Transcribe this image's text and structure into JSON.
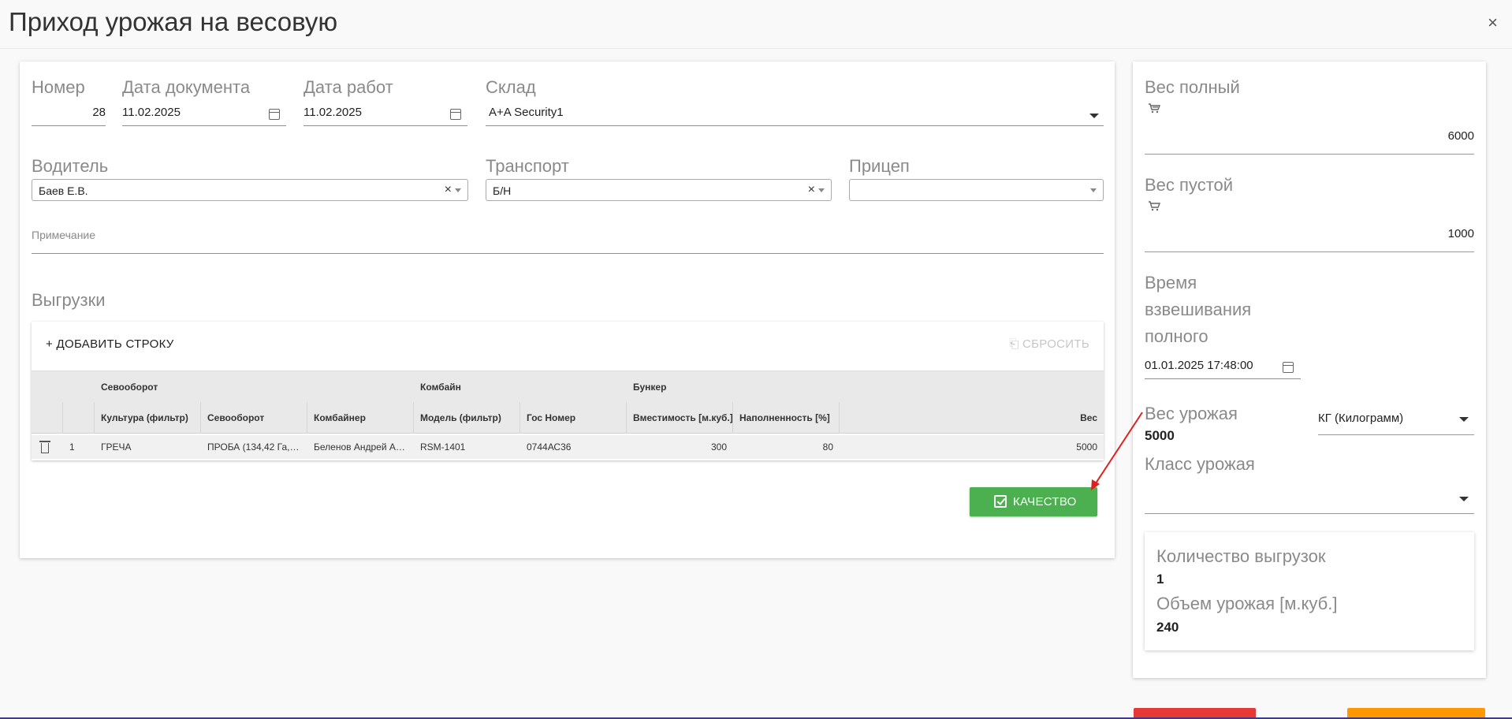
{
  "header": {
    "title": "Приход урожая на весовую",
    "close_glyph": "×"
  },
  "form": {
    "number": {
      "label": "Номер",
      "value": "28"
    },
    "doc_date": {
      "label": "Дата документа",
      "value": "11.02.2025"
    },
    "work_date": {
      "label": "Дата работ",
      "value": "11.02.2025"
    },
    "warehouse": {
      "label": "Склад",
      "value": "A+A Security1"
    },
    "driver": {
      "label": "Водитель",
      "value": "Баев Е.В."
    },
    "transport": {
      "label": "Транспорт",
      "value": "Б/Н"
    },
    "trailer": {
      "label": "Прицеп",
      "value": ""
    },
    "note": {
      "label": "Примечание",
      "value": ""
    }
  },
  "unloads": {
    "title": "Выгрузки",
    "add_label": "+ ДОБАВИТЬ СТРОКУ",
    "reset_label": "⎗ СБРОСИТЬ",
    "groups": [
      "Севооборот",
      "Комбайн",
      "Бункер"
    ],
    "columns": [
      "Культура (фильтр)",
      "Севооборот",
      "Комбайнер",
      "Модель (фильтр)",
      "Гос Номер",
      "Вместимость [м.куб.]",
      "Наполненность [%]",
      "Вес"
    ],
    "rows": [
      {
        "num": "1",
        "culture": "ГРЕЧА",
        "rotation": "ПРОБА (134,42 Га, \"...",
        "operator": "Беленов Андрей Ан...",
        "model": "RSM-1401",
        "plate": "0744АС36",
        "capacity": "300",
        "fill": "80",
        "weight": "5000"
      }
    ]
  },
  "quality_button": {
    "label": "КАЧЕСТВО"
  },
  "right": {
    "gross": {
      "label": "Вес полный",
      "value": "6000"
    },
    "tare": {
      "label": "Вес пустой",
      "value": "1000"
    },
    "weigh_time": {
      "label_lines": [
        "Время",
        "взвешивания",
        "полного"
      ],
      "value": "01.01.2025 17:48:00"
    },
    "harvest_weight": {
      "label": "Вес урожая",
      "value": "5000",
      "unit": "КГ (Килограмм)"
    },
    "harvest_class": {
      "label": "Класс урожая",
      "value": ""
    },
    "summary": {
      "count_label": "Количество выгрузок",
      "count_value": "1",
      "volume_label": "Объем урожая [м.куб.]",
      "volume_value": "240"
    }
  },
  "colors": {
    "primary_green": "#4caf50",
    "danger": "#e53935",
    "warning": "#ff9800",
    "annotation_arrow": "#e02020"
  }
}
